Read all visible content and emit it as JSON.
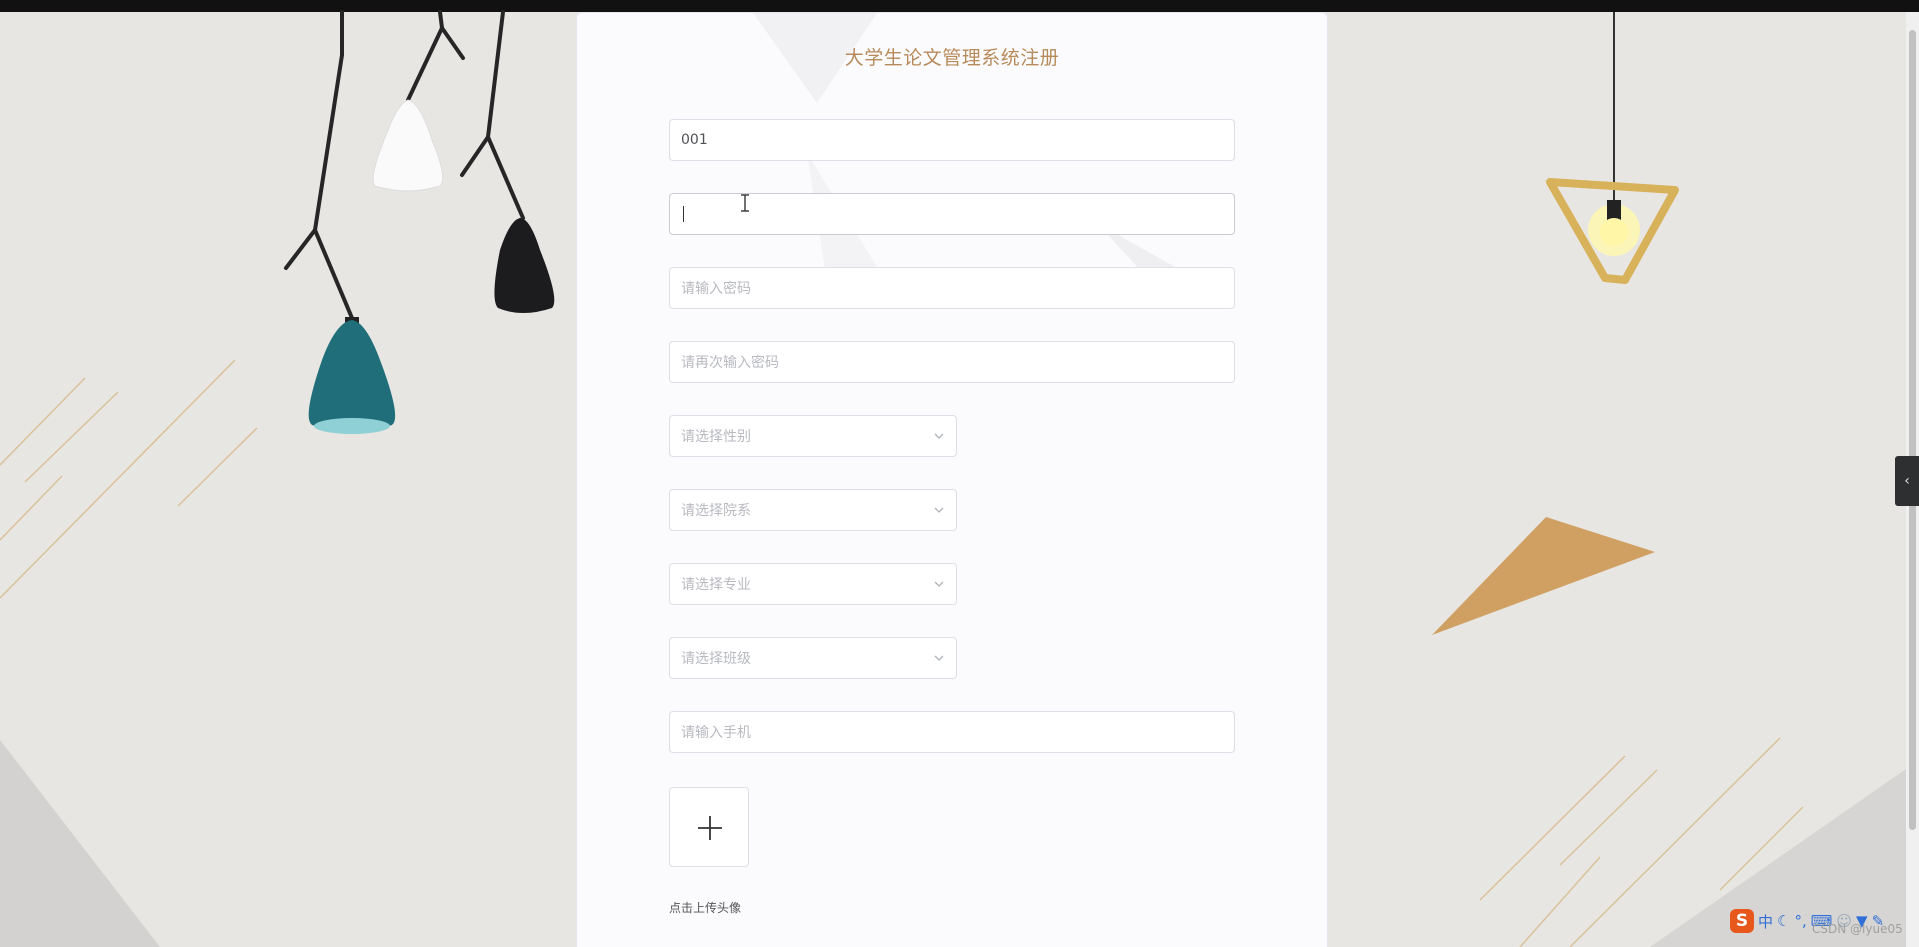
{
  "form": {
    "title": "大学生论文管理系统注册",
    "account_value": "001",
    "name_value": "",
    "password_placeholder": "请输入密码",
    "password_confirm_placeholder": "请再次输入密码",
    "gender_placeholder": "请选择性别",
    "department_placeholder": "请选择院系",
    "major_placeholder": "请选择专业",
    "class_placeholder": "请选择班级",
    "phone_placeholder": "请输入手机",
    "upload_label": "点击上传头像"
  },
  "side_tab": {
    "icon": "chevron-left-icon",
    "glyph": "‹"
  },
  "ime": {
    "logo": "S",
    "mode": "中",
    "icons": [
      "moon-icon",
      "punctuation-icon",
      "keyboard-icon",
      "user-icon",
      "shirt-icon",
      "wrench-icon"
    ]
  },
  "watermark": "CSDN @lyue05",
  "colors": {
    "title": "#b78a5a",
    "accent_gold": "#c99a55",
    "teal_lamp": "#1f6e79",
    "background": "#e8e6e3"
  }
}
